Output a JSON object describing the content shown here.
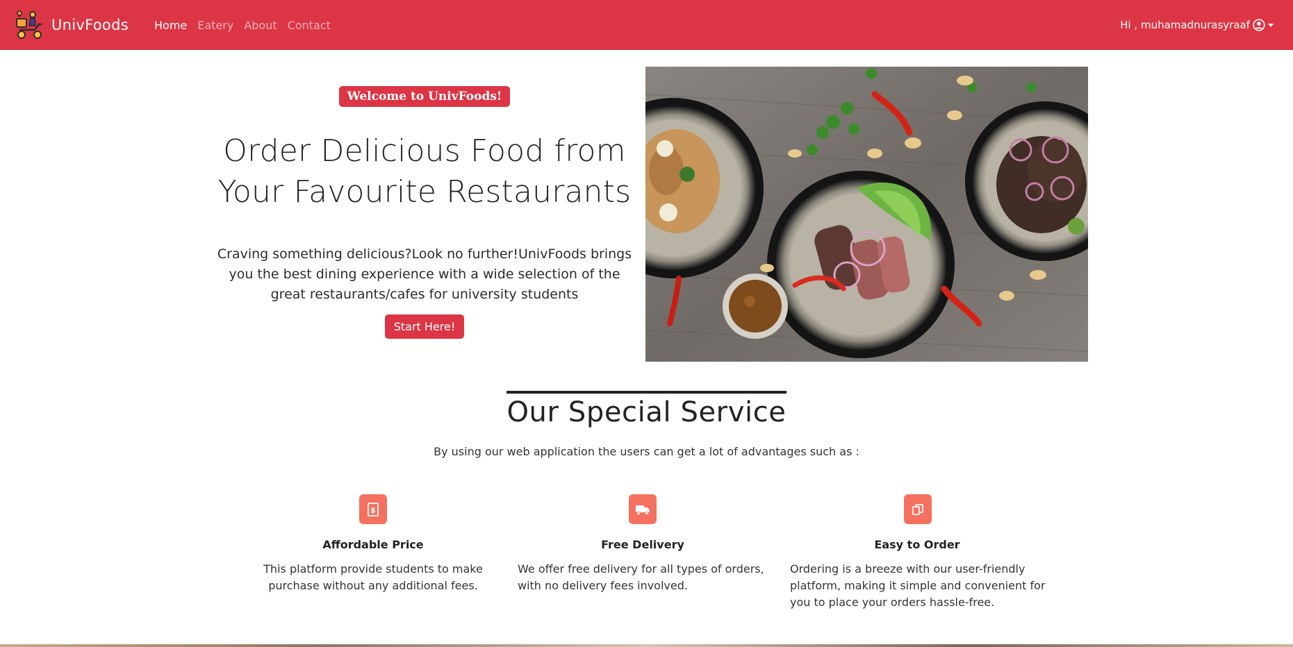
{
  "nav": {
    "brand": "UnivFoods",
    "links": [
      {
        "label": "Home",
        "active": true
      },
      {
        "label": "Eatery",
        "active": false
      },
      {
        "label": "About",
        "active": false
      },
      {
        "label": "Contact",
        "active": false
      }
    ],
    "user_greeting": "Hi , muhamadnurasyraaf",
    "user_icon": "user-circle-icon"
  },
  "hero": {
    "badge": "Welcome to UnivFoods!",
    "title_line1": "Order Delicious Food from",
    "title_line2": "Your Favourite Restaurants",
    "description": "Craving something delicious?Look no further!UnivFoods brings you the best dining experience with a wide selection of the great restaurants/cafes for university students",
    "cta_label": "Start Here!"
  },
  "service": {
    "title": "Our Special Service",
    "subtitle": "By using our web application the users can get a lot of advantages such as :",
    "features": [
      {
        "icon": "receipt-dollar-icon",
        "title": "Affordable Price",
        "text": "This platform provide students to make purchase without any additional fees."
      },
      {
        "icon": "truck-icon",
        "title": "Free Delivery",
        "text": "We offer free delivery for all types of orders, with no delivery fees involved."
      },
      {
        "icon": "copy-icon",
        "title": "Easy to Order",
        "text": "Ordering is a breeze with our user-friendly platform, making it simple and convenient for you to place your orders hassle-free."
      }
    ]
  },
  "colors": {
    "primary": "#dc3545",
    "feature_icon_bg": "#f4715f"
  }
}
